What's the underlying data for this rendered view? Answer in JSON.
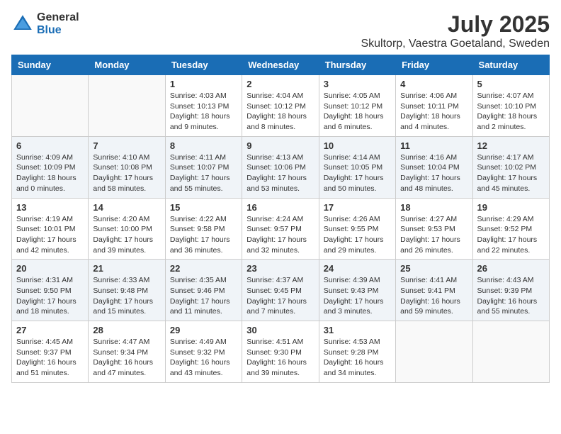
{
  "logo": {
    "general": "General",
    "blue": "Blue"
  },
  "title": {
    "month": "July 2025",
    "location": "Skultorp, Vaestra Goetaland, Sweden"
  },
  "weekdays": [
    "Sunday",
    "Monday",
    "Tuesday",
    "Wednesday",
    "Thursday",
    "Friday",
    "Saturday"
  ],
  "weeks": [
    [
      {
        "num": "",
        "info": ""
      },
      {
        "num": "",
        "info": ""
      },
      {
        "num": "1",
        "info": "Sunrise: 4:03 AM\nSunset: 10:13 PM\nDaylight: 18 hours\nand 9 minutes."
      },
      {
        "num": "2",
        "info": "Sunrise: 4:04 AM\nSunset: 10:12 PM\nDaylight: 18 hours\nand 8 minutes."
      },
      {
        "num": "3",
        "info": "Sunrise: 4:05 AM\nSunset: 10:12 PM\nDaylight: 18 hours\nand 6 minutes."
      },
      {
        "num": "4",
        "info": "Sunrise: 4:06 AM\nSunset: 10:11 PM\nDaylight: 18 hours\nand 4 minutes."
      },
      {
        "num": "5",
        "info": "Sunrise: 4:07 AM\nSunset: 10:10 PM\nDaylight: 18 hours\nand 2 minutes."
      }
    ],
    [
      {
        "num": "6",
        "info": "Sunrise: 4:09 AM\nSunset: 10:09 PM\nDaylight: 18 hours\nand 0 minutes."
      },
      {
        "num": "7",
        "info": "Sunrise: 4:10 AM\nSunset: 10:08 PM\nDaylight: 17 hours\nand 58 minutes."
      },
      {
        "num": "8",
        "info": "Sunrise: 4:11 AM\nSunset: 10:07 PM\nDaylight: 17 hours\nand 55 minutes."
      },
      {
        "num": "9",
        "info": "Sunrise: 4:13 AM\nSunset: 10:06 PM\nDaylight: 17 hours\nand 53 minutes."
      },
      {
        "num": "10",
        "info": "Sunrise: 4:14 AM\nSunset: 10:05 PM\nDaylight: 17 hours\nand 50 minutes."
      },
      {
        "num": "11",
        "info": "Sunrise: 4:16 AM\nSunset: 10:04 PM\nDaylight: 17 hours\nand 48 minutes."
      },
      {
        "num": "12",
        "info": "Sunrise: 4:17 AM\nSunset: 10:02 PM\nDaylight: 17 hours\nand 45 minutes."
      }
    ],
    [
      {
        "num": "13",
        "info": "Sunrise: 4:19 AM\nSunset: 10:01 PM\nDaylight: 17 hours\nand 42 minutes."
      },
      {
        "num": "14",
        "info": "Sunrise: 4:20 AM\nSunset: 10:00 PM\nDaylight: 17 hours\nand 39 minutes."
      },
      {
        "num": "15",
        "info": "Sunrise: 4:22 AM\nSunset: 9:58 PM\nDaylight: 17 hours\nand 36 minutes."
      },
      {
        "num": "16",
        "info": "Sunrise: 4:24 AM\nSunset: 9:57 PM\nDaylight: 17 hours\nand 32 minutes."
      },
      {
        "num": "17",
        "info": "Sunrise: 4:26 AM\nSunset: 9:55 PM\nDaylight: 17 hours\nand 29 minutes."
      },
      {
        "num": "18",
        "info": "Sunrise: 4:27 AM\nSunset: 9:53 PM\nDaylight: 17 hours\nand 26 minutes."
      },
      {
        "num": "19",
        "info": "Sunrise: 4:29 AM\nSunset: 9:52 PM\nDaylight: 17 hours\nand 22 minutes."
      }
    ],
    [
      {
        "num": "20",
        "info": "Sunrise: 4:31 AM\nSunset: 9:50 PM\nDaylight: 17 hours\nand 18 minutes."
      },
      {
        "num": "21",
        "info": "Sunrise: 4:33 AM\nSunset: 9:48 PM\nDaylight: 17 hours\nand 15 minutes."
      },
      {
        "num": "22",
        "info": "Sunrise: 4:35 AM\nSunset: 9:46 PM\nDaylight: 17 hours\nand 11 minutes."
      },
      {
        "num": "23",
        "info": "Sunrise: 4:37 AM\nSunset: 9:45 PM\nDaylight: 17 hours\nand 7 minutes."
      },
      {
        "num": "24",
        "info": "Sunrise: 4:39 AM\nSunset: 9:43 PM\nDaylight: 17 hours\nand 3 minutes."
      },
      {
        "num": "25",
        "info": "Sunrise: 4:41 AM\nSunset: 9:41 PM\nDaylight: 16 hours\nand 59 minutes."
      },
      {
        "num": "26",
        "info": "Sunrise: 4:43 AM\nSunset: 9:39 PM\nDaylight: 16 hours\nand 55 minutes."
      }
    ],
    [
      {
        "num": "27",
        "info": "Sunrise: 4:45 AM\nSunset: 9:37 PM\nDaylight: 16 hours\nand 51 minutes."
      },
      {
        "num": "28",
        "info": "Sunrise: 4:47 AM\nSunset: 9:34 PM\nDaylight: 16 hours\nand 47 minutes."
      },
      {
        "num": "29",
        "info": "Sunrise: 4:49 AM\nSunset: 9:32 PM\nDaylight: 16 hours\nand 43 minutes."
      },
      {
        "num": "30",
        "info": "Sunrise: 4:51 AM\nSunset: 9:30 PM\nDaylight: 16 hours\nand 39 minutes."
      },
      {
        "num": "31",
        "info": "Sunrise: 4:53 AM\nSunset: 9:28 PM\nDaylight: 16 hours\nand 34 minutes."
      },
      {
        "num": "",
        "info": ""
      },
      {
        "num": "",
        "info": ""
      }
    ]
  ]
}
